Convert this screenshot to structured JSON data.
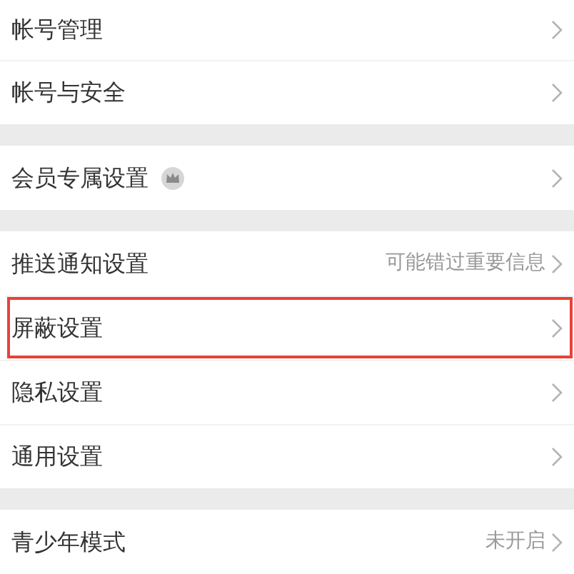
{
  "sections": [
    {
      "items": [
        {
          "label": "帐号管理",
          "badge": false,
          "highlighted": false
        },
        {
          "label": "帐号与安全",
          "badge": false,
          "highlighted": false
        }
      ]
    },
    {
      "items": [
        {
          "label": "会员专属设置",
          "badge": true,
          "highlighted": false
        }
      ]
    },
    {
      "items": [
        {
          "label": "推送通知设置",
          "value": "可能错过重要信息",
          "badge": false,
          "highlighted": false
        },
        {
          "label": "屏蔽设置",
          "badge": false,
          "highlighted": true
        },
        {
          "label": "隐私设置",
          "badge": false,
          "highlighted": false
        },
        {
          "label": "通用设置",
          "badge": false,
          "highlighted": false
        }
      ]
    },
    {
      "items": [
        {
          "label": "青少年模式",
          "value": "未开启",
          "badge": false,
          "highlighted": false
        }
      ]
    }
  ]
}
